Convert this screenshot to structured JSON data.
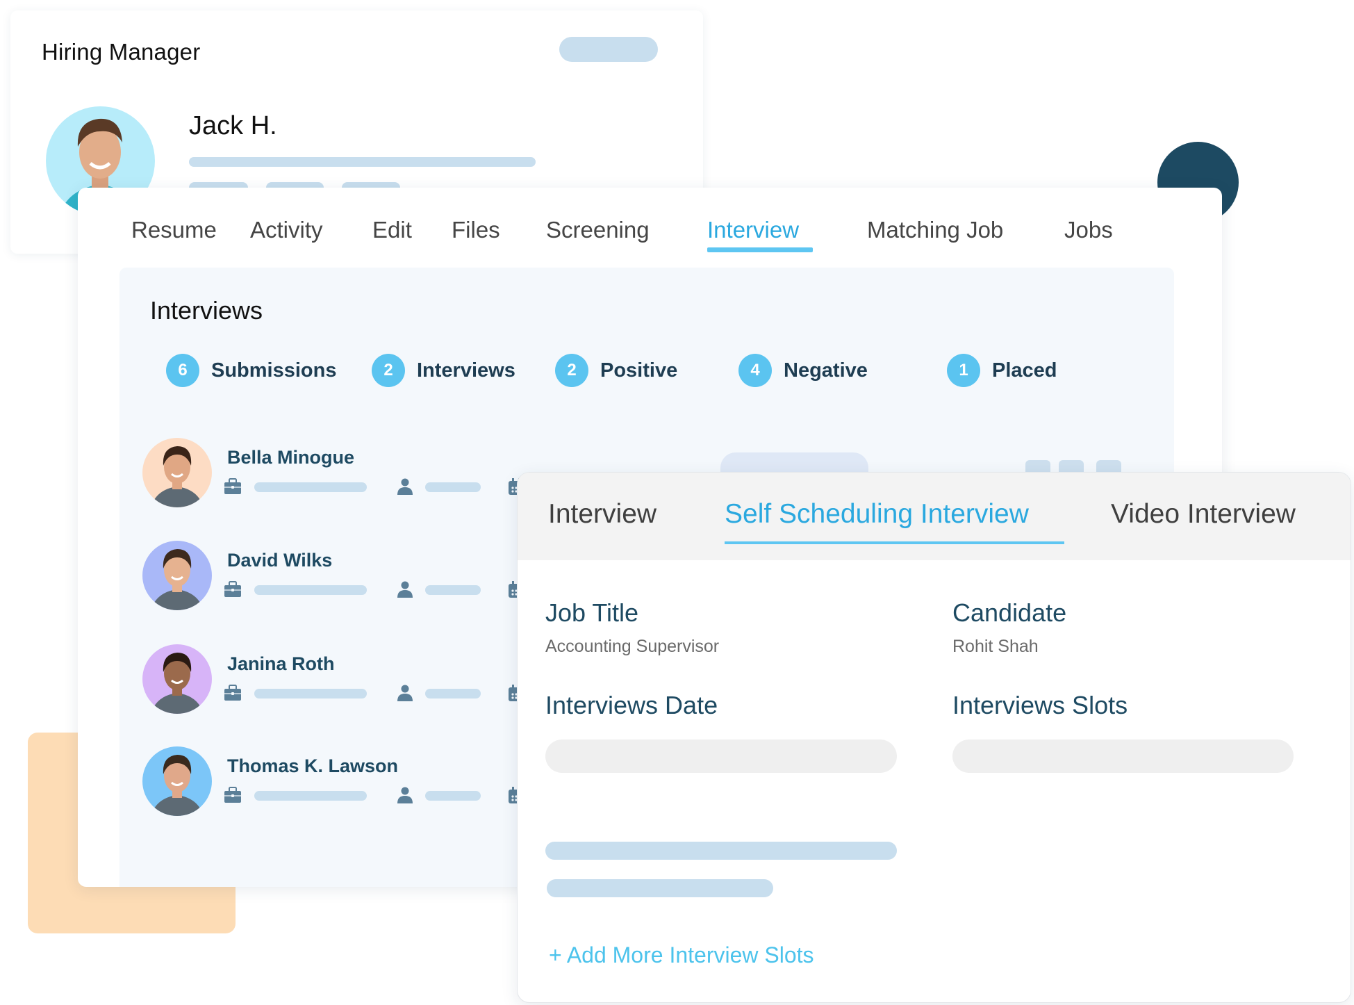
{
  "colors": {
    "accent": "#2aa8df",
    "badge": "#5bc4f0",
    "heading_dark": "#1e4a62",
    "decor_peach": "#fddcb5",
    "decor_dark": "#1d4a62",
    "placeholder_bar": "#c8deee"
  },
  "hiring_manager": {
    "title": "Hiring Manager",
    "name": "Jack H.",
    "avatar_icon": "person-photo-avatar"
  },
  "main_tabs": [
    {
      "label": "Resume",
      "active": false
    },
    {
      "label": "Activity",
      "active": false
    },
    {
      "label": "Edit",
      "active": false
    },
    {
      "label": "Files",
      "active": false
    },
    {
      "label": "Screening",
      "active": false
    },
    {
      "label": "Interview",
      "active": true
    },
    {
      "label": "Matching Job",
      "active": false
    },
    {
      "label": "Jobs",
      "active": false
    }
  ],
  "interviews_section": {
    "heading": "Interviews",
    "stats": [
      {
        "count": "6",
        "label": "Submissions"
      },
      {
        "count": "2",
        "label": "Interviews"
      },
      {
        "count": "2",
        "label": "Positive"
      },
      {
        "count": "4",
        "label": "Negative"
      },
      {
        "count": "1",
        "label": "Placed"
      }
    ],
    "candidates": [
      {
        "name": "Bella Minogue",
        "avatar_bg": "#fddcc4"
      },
      {
        "name": "David Wilks",
        "avatar_bg": "#a9b8f8"
      },
      {
        "name": "Janina Roth",
        "avatar_bg": "#d7b4f8"
      },
      {
        "name": "Thomas K. Lawson",
        "avatar_bg": "#7cc6f8"
      }
    ],
    "row_icons": [
      "briefcase-icon",
      "person-icon",
      "calendar-icon"
    ]
  },
  "scheduling_panel": {
    "tabs": [
      {
        "label": "Interview",
        "active": false
      },
      {
        "label": "Self Scheduling Interview",
        "active": true
      },
      {
        "label": "Video Interview",
        "active": false
      }
    ],
    "job_title_label": "Job Title",
    "job_title_value": "Accounting Supervisor",
    "candidate_label": "Candidate",
    "candidate_value": "Rohit Shah",
    "date_label": "Interviews Date",
    "slots_label": "Interviews Slots",
    "add_slots_label": "+ Add More Interview Slots"
  }
}
